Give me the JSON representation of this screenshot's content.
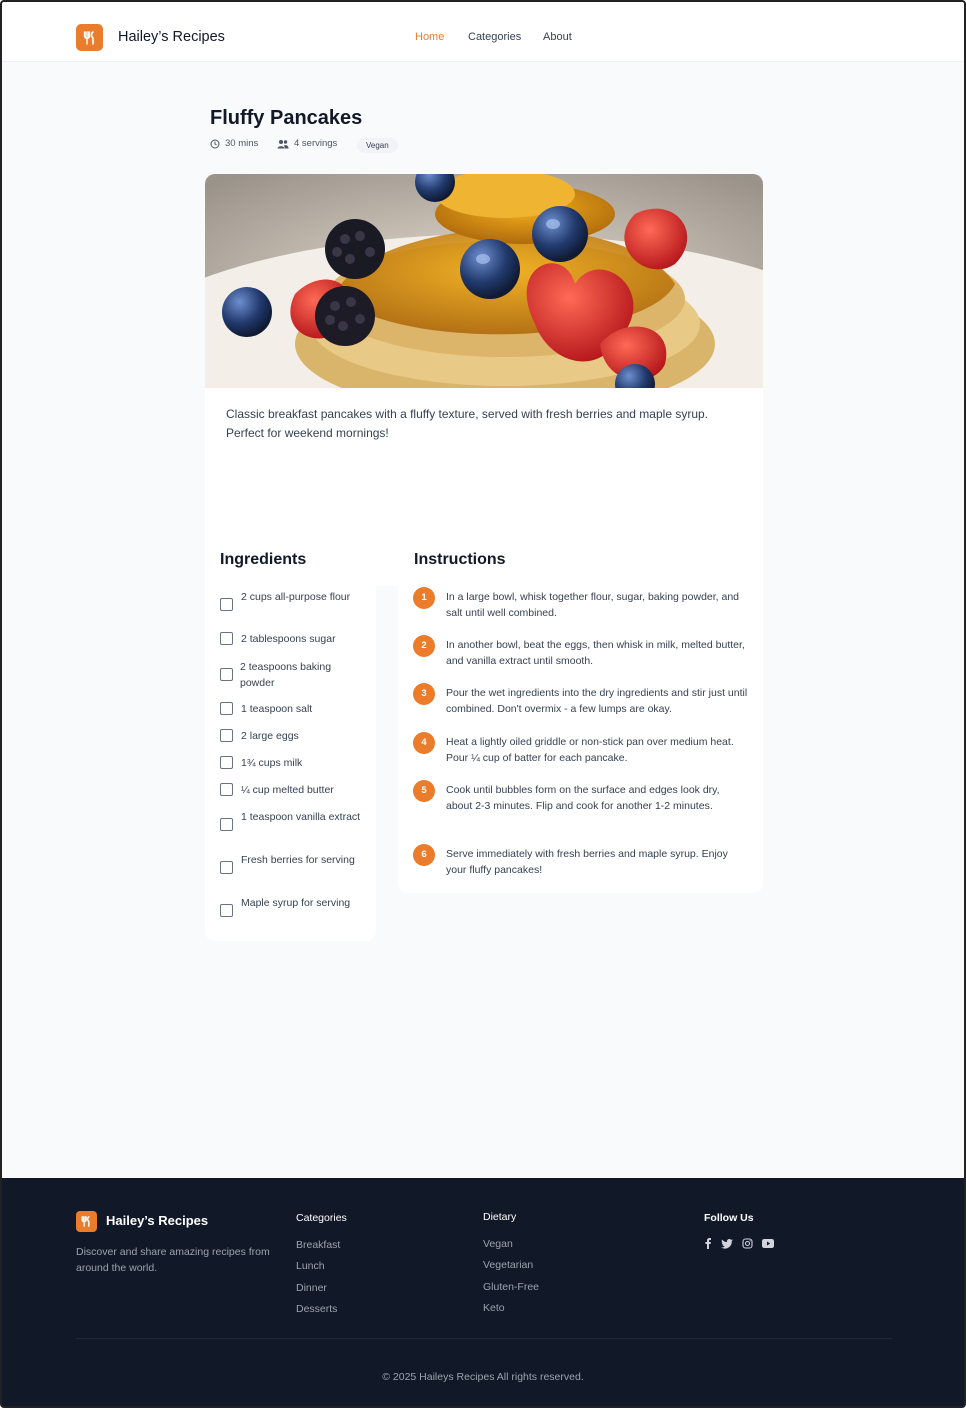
{
  "header": {
    "brand": "Hailey’s Recipes",
    "nav": [
      "Home",
      "Categories",
      "About"
    ],
    "active_nav": "Home",
    "accent_color": "#ea7c2c",
    "logo_icon": "utensils-icon"
  },
  "recipe": {
    "title": "Fluffy Pancakes",
    "time": "30 mins",
    "servings": "4 servings",
    "badge": "Vegan",
    "description": "Classic breakfast pancakes with a fluffy texture, served with fresh berries and maple syrup. Perfect for weekend mornings!"
  },
  "ingredients": {
    "title": "Ingredients",
    "items": [
      "2 cups all-purpose flour",
      "2 tablespoons sugar",
      "2 teaspoons baking powder",
      "1 teaspoon salt",
      "2 large eggs",
      "1¾ cups milk",
      "¼ cup melted butter",
      "1 teaspoon vanilla extract",
      "Fresh berries for serving",
      "Maple syrup for serving"
    ]
  },
  "instructions": {
    "title": "Instructions",
    "steps": [
      {
        "num": "1",
        "text": "In a large bowl, whisk together flour, sugar, baking powder, and salt until well combined."
      },
      {
        "num": "2",
        "text": "In another bowl, beat the eggs, then whisk in milk, melted butter, and vanilla extract until smooth."
      },
      {
        "num": "3",
        "text": "Pour the wet ingredients into the dry ingredients and stir just until combined. Don't overmix - a few lumps are okay."
      },
      {
        "num": "4",
        "text": "Heat a lightly oiled griddle or non-stick pan over medium heat. Pour ¼ cup of batter for each pancake."
      },
      {
        "num": "5",
        "text": "Cook until bubbles form on the surface and edges look dry, about 2-3 minutes. Flip and cook for another 1-2 minutes."
      },
      {
        "num": "6",
        "text": "Serve immediately with fresh berries and maple syrup. Enjoy your fluffy pancakes!"
      }
    ]
  },
  "footer": {
    "brand": "Hailey’s Recipes",
    "tagline": "Discover and share amazing recipes from around the world.",
    "categories_title": "Categories",
    "categories": [
      "Breakfast",
      "Lunch",
      "Dinner",
      "Desserts"
    ],
    "dietary_title": "Dietary",
    "dietary": [
      "Vegan",
      "Vegetarian",
      "Gluten-Free",
      "Keto"
    ],
    "follow_title": "Follow Us",
    "social_icons": [
      "facebook-icon",
      "twitter-icon",
      "instagram-icon",
      "youtube-icon"
    ],
    "copyright": "© 2025 Haileys Recipes All rights reserved."
  }
}
